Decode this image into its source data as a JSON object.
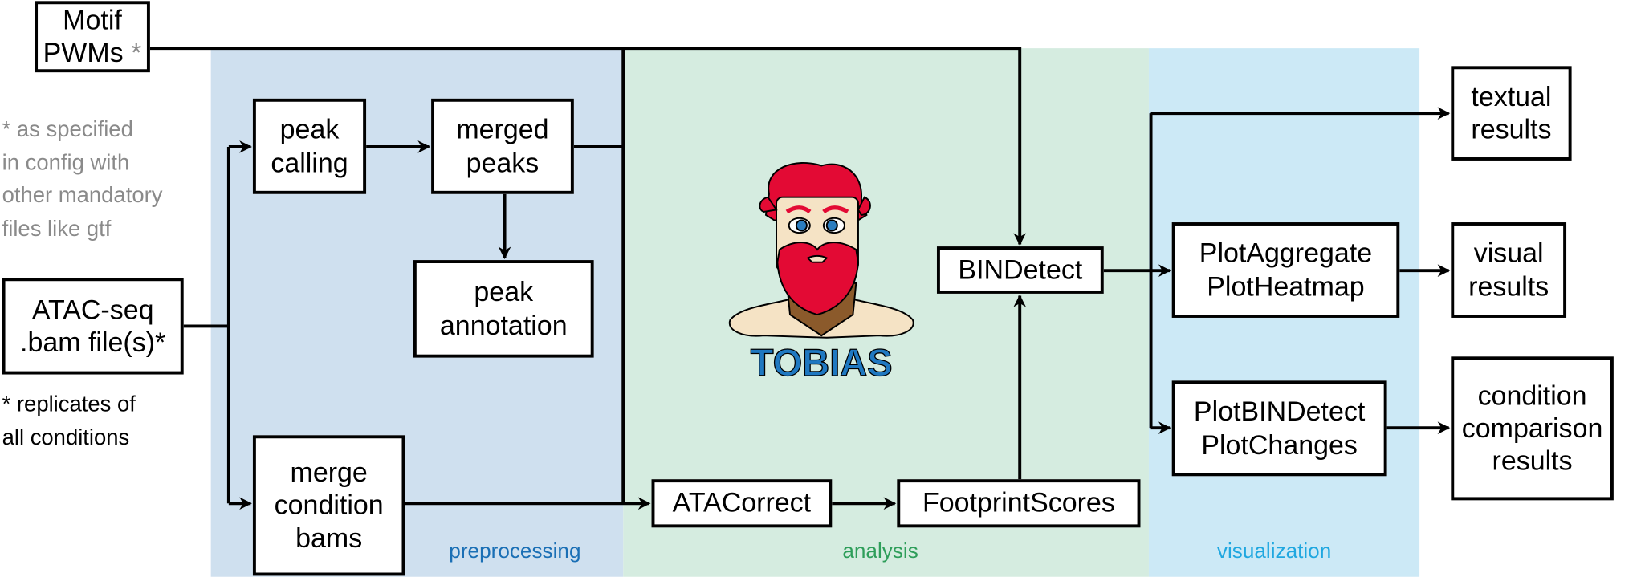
{
  "panels": {
    "preprocessing": {
      "label": "preprocessing",
      "color": "#cfe0ef",
      "label_color": "#1a6fb5"
    },
    "analysis": {
      "label": "analysis",
      "color": "#d5ece0",
      "label_color": "#2e9e5a"
    },
    "visualization": {
      "label": "visualization",
      "color": "#cce9f6",
      "label_color": "#1fa7e0"
    }
  },
  "inputs": {
    "motif": {
      "line1": "Motif",
      "line2": "PWMs",
      "asterisk": "*"
    },
    "motif_note": [
      "* as specified",
      "in config with",
      "other mandatory",
      "files like gtf"
    ],
    "atac": {
      "line1": "ATAC-seq",
      "line2": ".bam file(s)*"
    },
    "atac_note": [
      "* replicates of",
      "all conditions"
    ]
  },
  "nodes": {
    "peak_calling": [
      "peak",
      "calling"
    ],
    "merged_peaks": [
      "merged",
      "peaks"
    ],
    "peak_annotation": [
      "peak",
      "annotation"
    ],
    "merge_bams": [
      "merge",
      "condition",
      "bams"
    ],
    "atacorrect": "ATACorrect",
    "footprintscores": "FootprintScores",
    "bindetect": "BINDetect",
    "plot_aggregate": [
      "PlotAggregate",
      "PlotHeatmap"
    ],
    "plot_bindetect": [
      "PlotBINDetect",
      "PlotChanges"
    ],
    "textual_results": [
      "textual",
      "results"
    ],
    "visual_results": [
      "visual",
      "results"
    ],
    "comparison_results": [
      "condition",
      "comparison",
      "results"
    ]
  },
  "logo": {
    "text": "TOBIAS",
    "text_color": "#1f78c1",
    "hair_color": "#e30a34",
    "beard_lower_color": "#8b5a2b",
    "skin_color": "#f5e3c5",
    "eye_color": "#2b7dc0"
  }
}
